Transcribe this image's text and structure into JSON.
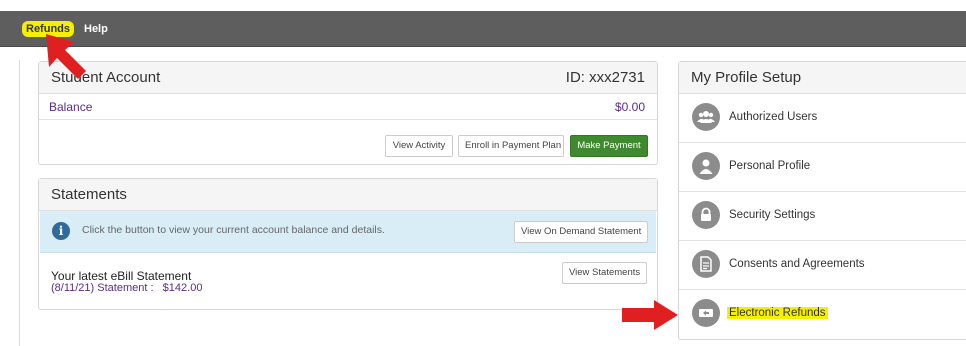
{
  "nav": {
    "refunds": "Refunds",
    "help": "Help"
  },
  "account": {
    "title": "Student Account",
    "id": "ID: xxx2731",
    "balance_label": "Balance",
    "balance_value": "$0.00",
    "buttons": {
      "view_activity": "View Activity",
      "enroll": "Enroll in Payment Plan",
      "make_payment": "Make Payment"
    }
  },
  "statements": {
    "title": "Statements",
    "info_text": "Click the button to view your current account balance and details.",
    "on_demand_button": "View On Demand Statement",
    "latest_title": "Your latest eBill Statement",
    "latest_line": "(8/11/21) Statement :   $142.00",
    "view_button": "View Statements"
  },
  "profile": {
    "title": "My Profile Setup",
    "items": [
      {
        "label": "Authorized Users",
        "icon": "users-icon"
      },
      {
        "label": "Personal Profile",
        "icon": "person-icon"
      },
      {
        "label": "Security Settings",
        "icon": "lock-icon"
      },
      {
        "label": "Consents and Agreements",
        "icon": "document-icon"
      },
      {
        "label": "Electronic Refunds",
        "icon": "refund-icon"
      }
    ]
  },
  "colors": {
    "highlight": "#f4f000",
    "arrow": "#e02020",
    "button_green": "#3f8a2e",
    "link_purple": "#5a2d82",
    "info_bg": "#d9edf7"
  }
}
